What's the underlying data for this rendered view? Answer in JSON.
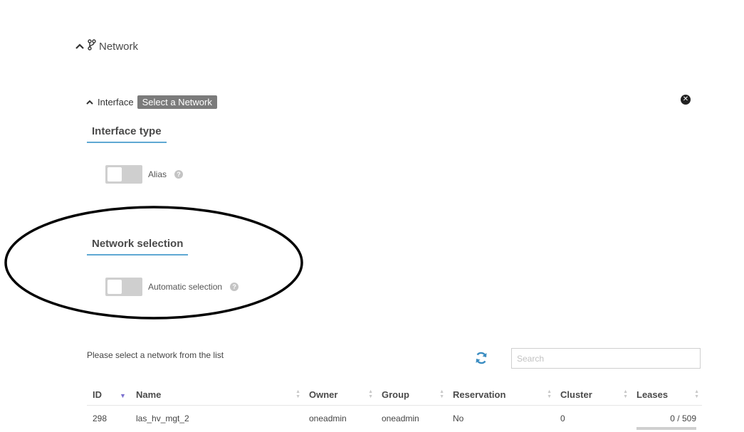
{
  "section": {
    "title": "Network"
  },
  "interface": {
    "label": "Interface",
    "badge": "Select a Network",
    "close_glyph": "✕"
  },
  "interface_type": {
    "heading": "Interface type",
    "alias_label": "Alias",
    "alias_on": false
  },
  "network_selection": {
    "heading": "Network selection",
    "auto_label": "Automatic selection",
    "auto_on": false
  },
  "list": {
    "hint": "Please select a network from the list",
    "search_placeholder": "Search"
  },
  "table": {
    "columns": [
      "ID",
      "Name",
      "Owner",
      "Group",
      "Reservation",
      "Cluster",
      "Leases"
    ],
    "rows": [
      {
        "id": "298",
        "name": "las_hv_mgt_2",
        "owner": "oneadmin",
        "group": "oneadmin",
        "reservation": "No",
        "cluster": "0",
        "leases": "0 / 509",
        "leases_used_fraction": 0
      }
    ]
  },
  "colors": {
    "accent": "#5fa8d3",
    "badge_bg": "#7b7b7b",
    "refresh_icon": "#3a8cc1",
    "annotation_ellipse": "#000000"
  }
}
